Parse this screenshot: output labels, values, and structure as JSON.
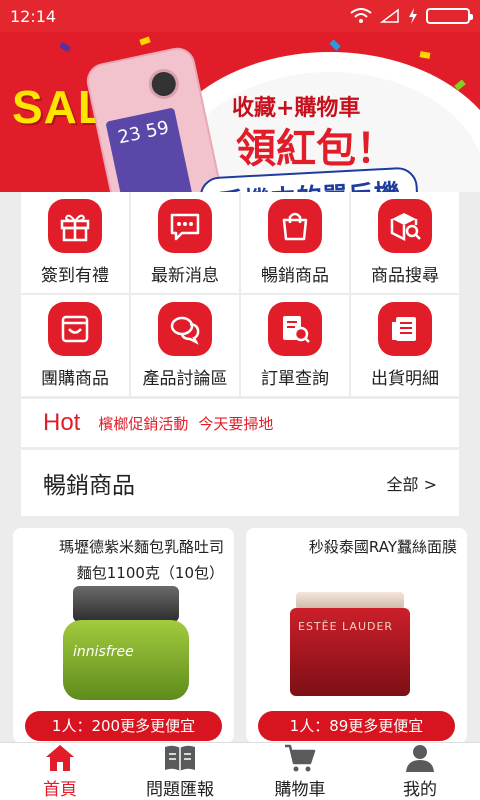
{
  "status_bar": {
    "time": "12:14"
  },
  "banner": {
    "sale": "SALE",
    "line1": "收藏+購物車",
    "line2": "領紅包！",
    "line3": "手機中的單反機",
    "phone_screen_text": "23 59"
  },
  "grid": [
    {
      "label": "簽到有禮",
      "icon": "gift-icon"
    },
    {
      "label": "最新消息",
      "icon": "message-icon"
    },
    {
      "label": "暢銷商品",
      "icon": "shopping-bag-icon"
    },
    {
      "label": "商品搜尋",
      "icon": "search-box-icon"
    },
    {
      "label": "團購商品",
      "icon": "group-buy-icon"
    },
    {
      "label": "產品討論區",
      "icon": "chat-icon"
    },
    {
      "label": "訂單查詢",
      "icon": "order-search-icon"
    },
    {
      "label": "出貨明細",
      "icon": "shipping-list-icon"
    }
  ],
  "hot": {
    "title": "Hot",
    "items": [
      "檳榔促銷活動",
      "今天要掃地"
    ]
  },
  "section": {
    "title": "暢銷商品",
    "all_label": "全部 >"
  },
  "products": [
    {
      "name_line1": "瑪壢德紫米麵包乳酪吐司",
      "name_line2": "麵包1100克（10包）",
      "price": "1人：200更多更便宜",
      "brand": "innisfree"
    },
    {
      "name_line1": "",
      "name_line2": "秒殺泰國RAY蠶絲面膜",
      "price": "1人：89更多更便宜",
      "brand": "ESTĒE LAUDER"
    }
  ],
  "tabs": [
    {
      "label": "首頁",
      "icon": "home-icon",
      "active": true
    },
    {
      "label": "問題匯報",
      "icon": "report-icon",
      "active": false
    },
    {
      "label": "購物車",
      "icon": "cart-icon",
      "active": false
    },
    {
      "label": "我的",
      "icon": "user-icon",
      "active": false
    }
  ],
  "colors": {
    "accent": "#e21d2a",
    "background": "#ececec"
  }
}
